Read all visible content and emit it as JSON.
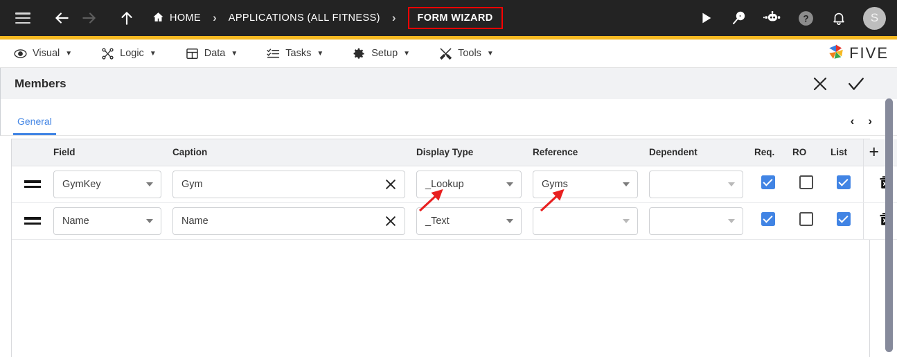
{
  "topbar": {
    "nav": {
      "menu_icon": "hamburger-icon",
      "back_icon": "arrow-left-icon",
      "forward_icon": "arrow-right-icon",
      "up_icon": "arrow-up-icon"
    },
    "breadcrumb": {
      "home_label": "HOME",
      "home_icon": "home-icon",
      "separator": "›",
      "app_label": "APPLICATIONS (ALL FITNESS)",
      "current_label": "FORM WIZARD",
      "current_highlight_color": "#fc0000"
    },
    "actions": [
      {
        "name": "run-icon",
        "label": "Run"
      },
      {
        "name": "search-play-icon",
        "label": "Debug"
      },
      {
        "name": "chat-bot-icon",
        "label": "Assistant"
      },
      {
        "name": "help-icon",
        "label": "Help"
      },
      {
        "name": "notifications-bell-icon",
        "label": "Notifications"
      }
    ],
    "avatar_initial": "S",
    "background_color": "#232323",
    "accent_bar_color": "#f5b921"
  },
  "menubar": {
    "items": [
      {
        "label": "Visual",
        "icon": "eye-icon",
        "caret": "▼"
      },
      {
        "label": "Logic",
        "icon": "logic-nodes-icon",
        "caret": "▼"
      },
      {
        "label": "Data",
        "icon": "table-grid-icon",
        "caret": "▼"
      },
      {
        "label": "Tasks",
        "icon": "checklist-icon",
        "caret": "▼"
      },
      {
        "label": "Setup",
        "icon": "gear-icon",
        "caret": "▼"
      },
      {
        "label": "Tools",
        "icon": "tools-icon",
        "caret": "▼"
      }
    ],
    "brand": {
      "text": "FIVE",
      "logo_icon": "five-pinwheel-logo"
    }
  },
  "panel": {
    "title": "Members",
    "close_label": "Close",
    "confirm_label": "Save",
    "close_icon": "close-x-icon",
    "confirm_icon": "check-icon"
  },
  "tabs": {
    "items": [
      {
        "label": "General",
        "active": true
      }
    ],
    "active_color": "#4184e4",
    "pager": {
      "prev": "‹",
      "next": "›"
    }
  },
  "grid": {
    "columns": [
      {
        "key": "handle",
        "label": ""
      },
      {
        "key": "field",
        "label": "Field"
      },
      {
        "key": "caption",
        "label": "Caption"
      },
      {
        "key": "dtype",
        "label": "Display Type"
      },
      {
        "key": "ref",
        "label": "Reference"
      },
      {
        "key": "dep",
        "label": "Dependent"
      },
      {
        "key": "req",
        "label": "Req."
      },
      {
        "key": "ro",
        "label": "RO"
      },
      {
        "key": "list",
        "label": "List"
      },
      {
        "key": "add",
        "label": "+"
      }
    ],
    "rows": [
      {
        "field": "GymKey",
        "caption": "Gym",
        "display_type": "_Lookup",
        "reference": "Gyms",
        "dependent": "",
        "required": true,
        "readonly": false,
        "list": true,
        "delete_icon": "delete-trash-icon"
      },
      {
        "field": "Name",
        "caption": "Name",
        "display_type": "_Text",
        "reference": "",
        "dependent": "",
        "required": true,
        "readonly": false,
        "list": true,
        "delete_icon": "delete-trash-icon"
      }
    ],
    "checkbox_on_color": "#4184e4",
    "header_bg": "#f1f2f4"
  },
  "annotations": {
    "arrow_color": "#e82020",
    "arrows": [
      {
        "name": "arrow-to-display-type",
        "points_at": "_Lookup"
      },
      {
        "name": "arrow-to-reference",
        "points_at": "Gyms"
      }
    ]
  }
}
